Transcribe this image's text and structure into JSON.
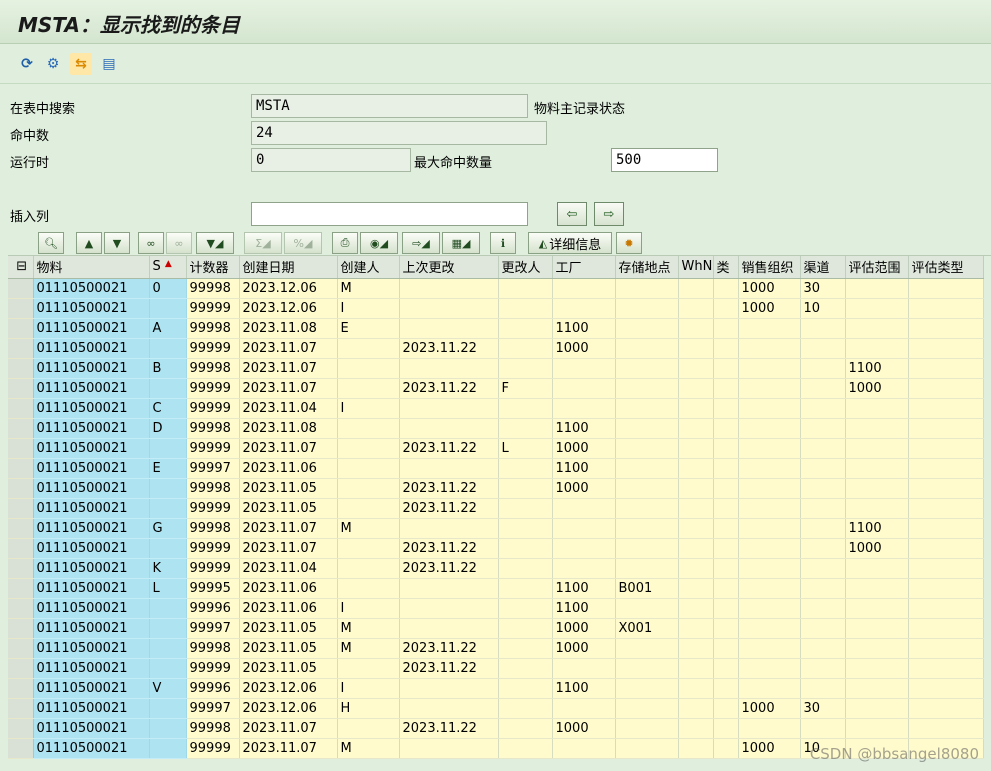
{
  "window": {
    "title": "MSTA：显示找到的条目"
  },
  "toolbar": {
    "icons": [
      "refresh-icon",
      "technical-settings-icon",
      "check-table-icon",
      "documentation-icon"
    ]
  },
  "form": {
    "search_table_label": "在表中搜索",
    "search_table_value": "MSTA",
    "search_table_desc": "物料主记录状态",
    "hits_label": "命中数",
    "hits_value": "24",
    "runtime_label": "运行时",
    "runtime_value": "0",
    "max_hits_label": "最大命中数量",
    "max_hits_value": "500",
    "insert_col_label": "插入列",
    "insert_col_value": ""
  },
  "alv_toolbar": {
    "detail_label": "详细信息"
  },
  "table": {
    "columns": [
      "物料",
      "S",
      "计数器",
      "创建日期",
      "创建人",
      "上次更改",
      "更改人",
      "工厂",
      "存储地点",
      "WhN",
      "类",
      "销售组织",
      "渠道",
      "评估范围",
      "评估类型"
    ],
    "rows": [
      [
        "01110500021",
        "0",
        "99998",
        "2023.12.06",
        "M",
        "",
        "",
        "",
        "",
        "",
        "",
        "1000",
        "30",
        "",
        ""
      ],
      [
        "01110500021",
        "",
        "99999",
        "2023.12.06",
        "I",
        "",
        "",
        "",
        "",
        "",
        "",
        "1000",
        "10",
        "",
        ""
      ],
      [
        "01110500021",
        "A",
        "99998",
        "2023.11.08",
        "E",
        "",
        "",
        "1100",
        "",
        "",
        "",
        "",
        "",
        "",
        ""
      ],
      [
        "01110500021",
        "",
        "99999",
        "2023.11.07",
        "",
        "2023.11.22",
        "",
        "1000",
        "",
        "",
        "",
        "",
        "",
        "",
        ""
      ],
      [
        "01110500021",
        "B",
        "99998",
        "2023.11.07",
        "",
        "",
        "",
        "",
        "",
        "",
        "",
        "",
        "",
        "1100",
        ""
      ],
      [
        "01110500021",
        "",
        "99999",
        "2023.11.07",
        "",
        "2023.11.22",
        "F",
        "",
        "",
        "",
        "",
        "",
        "",
        "1000",
        ""
      ],
      [
        "01110500021",
        "C",
        "99999",
        "2023.11.04",
        "I",
        "",
        "",
        "",
        "",
        "",
        "",
        "",
        "",
        "",
        ""
      ],
      [
        "01110500021",
        "D",
        "99998",
        "2023.11.08",
        "",
        "",
        "",
        "1100",
        "",
        "",
        "",
        "",
        "",
        "",
        ""
      ],
      [
        "01110500021",
        "",
        "99999",
        "2023.11.07",
        "",
        "2023.11.22",
        "L",
        "1000",
        "",
        "",
        "",
        "",
        "",
        "",
        ""
      ],
      [
        "01110500021",
        "E",
        "99997",
        "2023.11.06",
        "",
        "",
        "",
        "1100",
        "",
        "",
        "",
        "",
        "",
        "",
        ""
      ],
      [
        "01110500021",
        "",
        "99998",
        "2023.11.05",
        "",
        "2023.11.22",
        "",
        "1000",
        "",
        "",
        "",
        "",
        "",
        "",
        ""
      ],
      [
        "01110500021",
        "",
        "99999",
        "2023.11.05",
        "",
        "2023.11.22",
        "",
        "",
        "",
        "",
        "",
        "",
        "",
        "",
        ""
      ],
      [
        "01110500021",
        "G",
        "99998",
        "2023.11.07",
        "M",
        "",
        "",
        "",
        "",
        "",
        "",
        "",
        "",
        "1100",
        ""
      ],
      [
        "01110500021",
        "",
        "99999",
        "2023.11.07",
        "",
        "2023.11.22",
        "",
        "",
        "",
        "",
        "",
        "",
        "",
        "1000",
        ""
      ],
      [
        "01110500021",
        "K",
        "99999",
        "2023.11.04",
        "",
        "2023.11.22",
        "",
        "",
        "",
        "",
        "",
        "",
        "",
        "",
        ""
      ],
      [
        "01110500021",
        "L",
        "99995",
        "2023.11.06",
        "",
        "",
        "",
        "1100",
        "B001",
        "",
        "",
        "",
        "",
        "",
        ""
      ],
      [
        "01110500021",
        "",
        "99996",
        "2023.11.06",
        "I",
        "",
        "",
        "1100",
        "",
        "",
        "",
        "",
        "",
        "",
        ""
      ],
      [
        "01110500021",
        "",
        "99997",
        "2023.11.05",
        "M",
        "",
        "",
        "1000",
        "X001",
        "",
        "",
        "",
        "",
        "",
        ""
      ],
      [
        "01110500021",
        "",
        "99998",
        "2023.11.05",
        "M",
        "2023.11.22",
        "",
        "1000",
        "",
        "",
        "",
        "",
        "",
        "",
        ""
      ],
      [
        "01110500021",
        "",
        "99999",
        "2023.11.05",
        "",
        "2023.11.22",
        "",
        "",
        "",
        "",
        "",
        "",
        "",
        "",
        ""
      ],
      [
        "01110500021",
        "V",
        "99996",
        "2023.12.06",
        "I",
        "",
        "",
        "1100",
        "",
        "",
        "",
        "",
        "",
        "",
        ""
      ],
      [
        "01110500021",
        "",
        "99997",
        "2023.12.06",
        "H",
        "",
        "",
        "",
        "",
        "",
        "",
        "1000",
        "30",
        "",
        ""
      ],
      [
        "01110500021",
        "",
        "99998",
        "2023.11.07",
        "",
        "2023.11.22",
        "",
        "1000",
        "",
        "",
        "",
        "",
        "",
        "",
        ""
      ],
      [
        "01110500021",
        "",
        "99999",
        "2023.11.07",
        "M",
        "",
        "",
        "",
        "",
        "",
        "",
        "1000",
        "10",
        "",
        ""
      ]
    ]
  },
  "watermark": "CSDN @bbsangel8080"
}
